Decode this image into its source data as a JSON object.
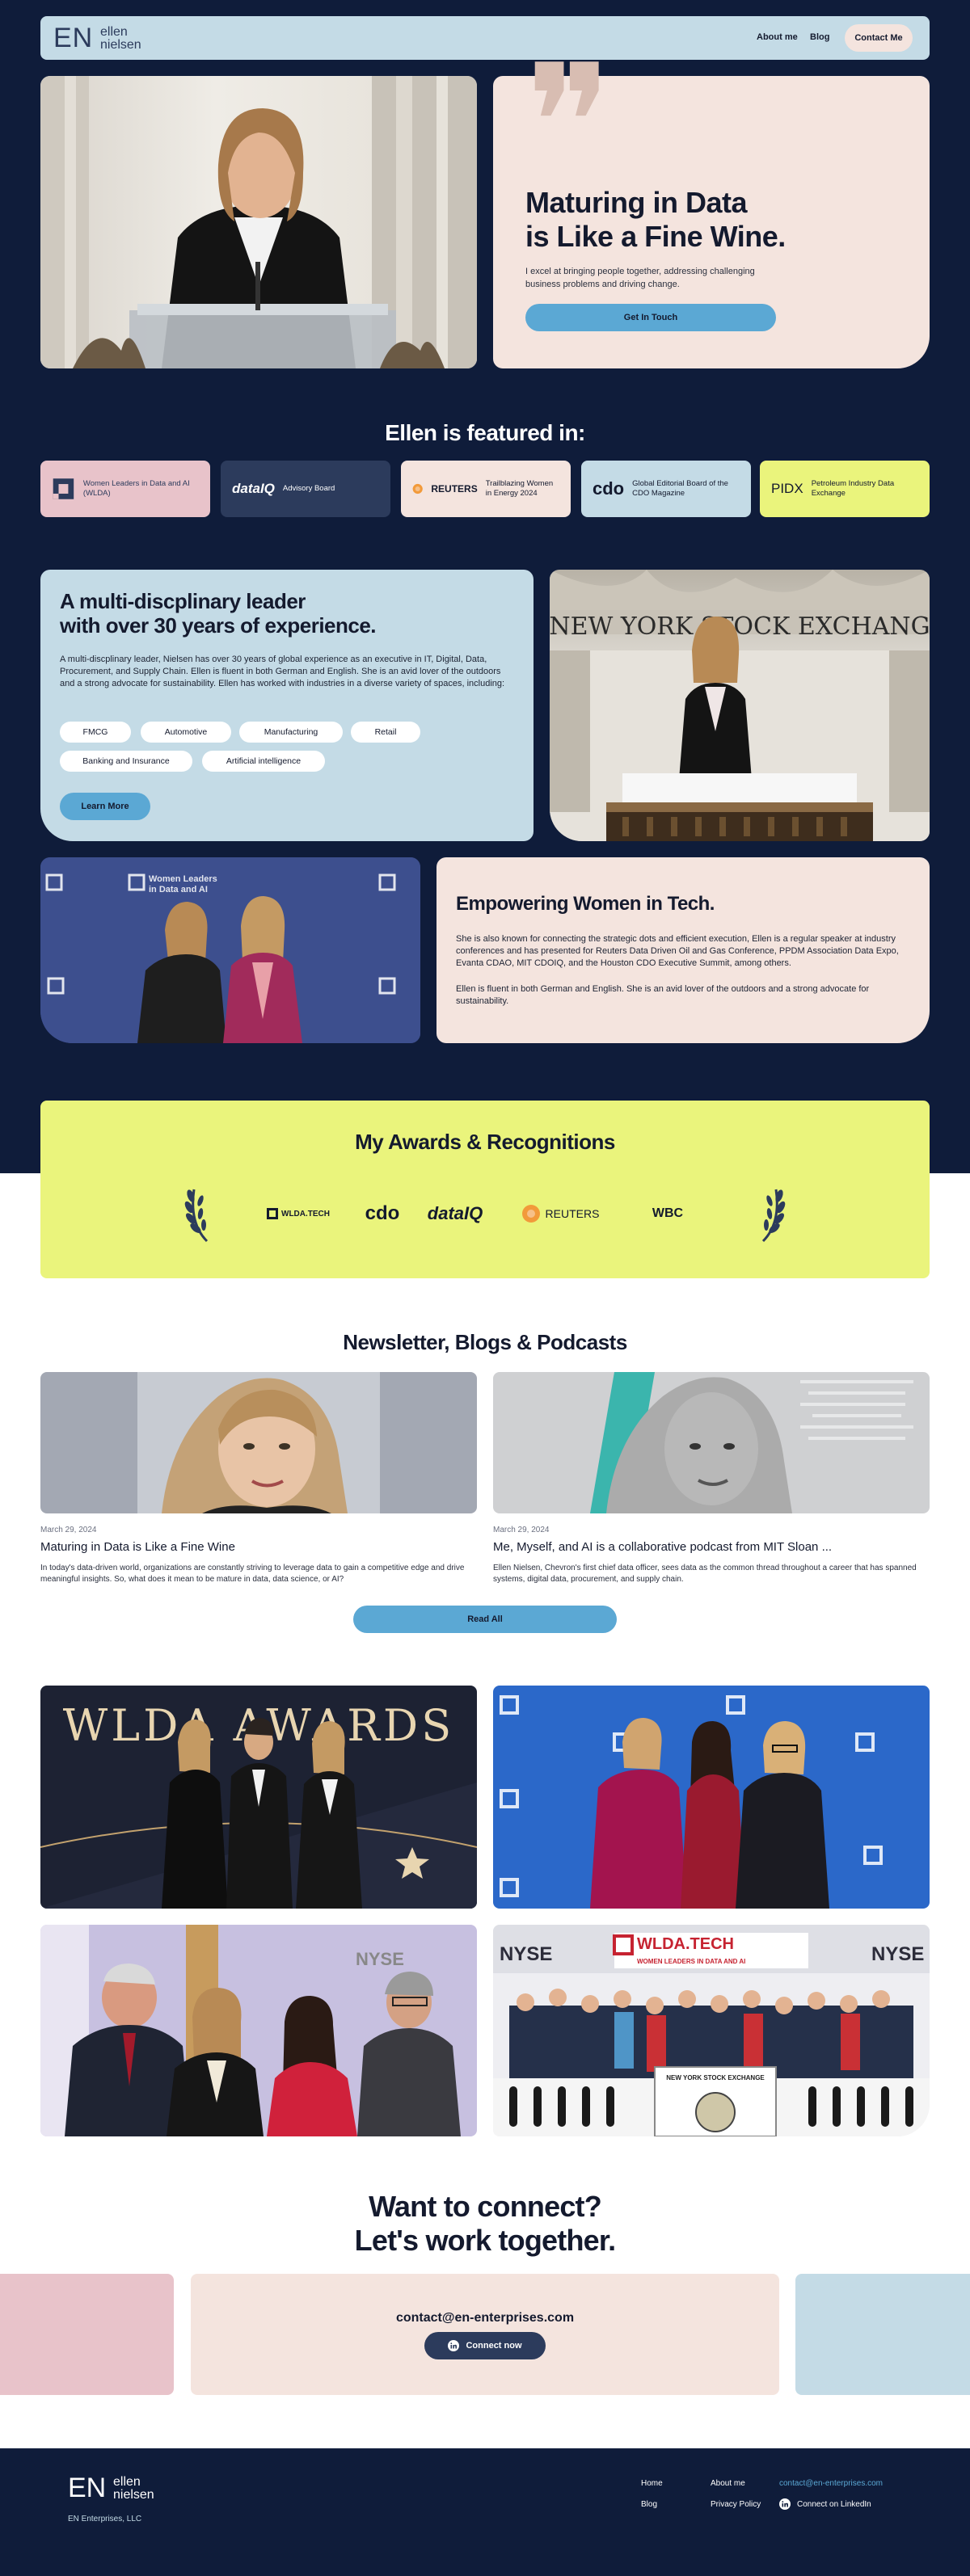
{
  "nav": {
    "logo_mark": "EN",
    "logo_line1": "ellen",
    "logo_line2": "nielsen",
    "links": [
      "About me",
      "Blog"
    ],
    "contact": "Contact Me"
  },
  "hero": {
    "title_line1": "Maturing in Data",
    "title_line2": "is Like a Fine Wine.",
    "description": "I excel at bringing people together, addressing challenging business problems and driving change.",
    "button": "Get In Touch"
  },
  "featured": {
    "title": "Ellen is featured in:",
    "items": [
      {
        "logo": "",
        "text": "Women Leaders in Data and AI (WLDA)",
        "bg": "#e8c3ca"
      },
      {
        "logo": "dataIQ",
        "text": "Advisory Board",
        "bg": "#2c3b5c"
      },
      {
        "logo": "REUTERS",
        "text": "Trailblazing Women in Energy 2024",
        "bg": "#f4e4de"
      },
      {
        "logo": "cdo",
        "text": "Global Editorial Board of the CDO Magazine",
        "bg": "#c4dbe6"
      },
      {
        "logo": "PIDX",
        "text": "Petroleum Industry Data Exchange",
        "bg": "#eaf47c"
      }
    ]
  },
  "leader": {
    "title_line1": "A multi-discplinary leader",
    "title_line2": "with over 30 years of experience.",
    "description": "A multi-discplinary leader, Nielsen has over 30 years of global experience as an executive in IT, Digital, Data, Procurement, and Supply Chain.  Ellen is fluent in both German and English. She is an avid lover of the outdoors and a strong advocate for sustainability. Ellen has worked with industries in a diverse variety of spaces, including:",
    "tags": [
      "FMCG",
      "Automotive",
      "Manufacturing",
      "Retail",
      "Banking and Insurance",
      "Artificial intelligence"
    ],
    "button": "Learn More"
  },
  "nyse_photo": {
    "sign": "NEW YORK STOCK EXCHANG"
  },
  "wlda_banner": {
    "line1": "Women Leaders",
    "line2": "in Data and AI"
  },
  "empower": {
    "title": "Empowering Women in Tech.",
    "p1": "She is also known for connecting the strategic dots and efficient execution, Ellen is a regular speaker at industry conferences and has presented for Reuters Data Driven Oil and Gas Conference, PPDM Association Data Expo, Evanta CDAO, MIT CDOIQ, and the Houston CDO Executive Summit, among others.",
    "p2": "Ellen is fluent in both German and English. She is an avid lover of the outdoors and a strong advocate for sustainability."
  },
  "awards": {
    "title": "My Awards & Recognitions",
    "logos": [
      "WLDA.TECH",
      "cdo",
      "dataIQ",
      "REUTERS",
      "WBC"
    ]
  },
  "news": {
    "title": "Newsletter, Blogs & Podcasts",
    "posts": [
      {
        "date": "March 29, 2024",
        "title": "Maturing in Data is Like a Fine Wine",
        "excerpt": "In today's data-driven world, organizations are constantly striving to leverage data to gain a competitive edge and drive meaningful insights. So, what does it mean to be mature in data, data science, or AI?"
      },
      {
        "date": "March 29, 2024",
        "title": "Me, Myself, and AI is a collaborative podcast from MIT Sloan ...",
        "excerpt": "Ellen Nielsen, Chevron's first chief data officer, sees data as the common thread throughout a career that has spanned systems, digital data, procurement, and supply chain."
      }
    ],
    "read_all": "Read All"
  },
  "gallery": {
    "wlda_awards": "WLDA AWARDS",
    "nyse": "NYSE",
    "wlda_tech": "WLDA.TECH",
    "wlda_tech_sub": "WOMEN LEADERS IN DATA AND AI",
    "podium": "NEW YORK STOCK EXCHANGE"
  },
  "connect": {
    "title_line1": "Want to connect?",
    "title_line2": "Let's work together.",
    "email": "contact@en-enterprises.com",
    "button": "Connect now"
  },
  "footer": {
    "logo_mark": "EN",
    "logo_line1": "ellen",
    "logo_line2": "nielsen",
    "company": "EN Enterprises, LLC",
    "links": [
      "Home",
      "About me",
      "Blog",
      "Privacy Policy"
    ],
    "email": "contact@en-enterprises.com",
    "linkedin": "Connect on LinkedIn"
  }
}
